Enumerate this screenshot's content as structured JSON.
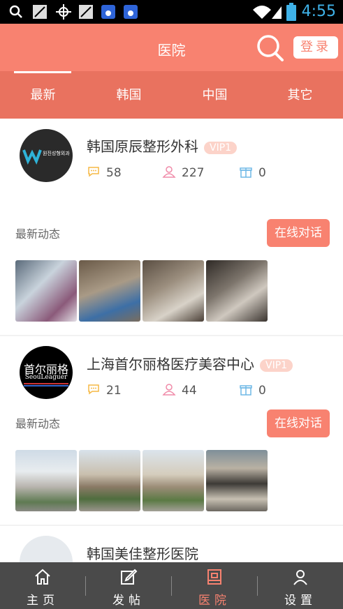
{
  "status_bar": {
    "time": "4:55"
  },
  "header": {
    "title": "医院",
    "login_label": "登录"
  },
  "tabs": [
    {
      "label": "最新",
      "active": true
    },
    {
      "label": "韩国",
      "active": false
    },
    {
      "label": "中国",
      "active": false
    },
    {
      "label": "其它",
      "active": false
    }
  ],
  "hospitals": [
    {
      "name": "韩国原辰整形外科",
      "badge": "VIP1",
      "comments": "58",
      "followers": "227",
      "gifts": "0",
      "news_label": "最新动态",
      "chat_label": "在线对话",
      "logo_text": "원진성형외과"
    },
    {
      "name": "上海首尔丽格医疗美容中心",
      "badge": "VIP1",
      "comments": "21",
      "followers": "44",
      "gifts": "0",
      "news_label": "最新动态",
      "chat_label": "在线对话",
      "logo_text": "首尔丽格",
      "logo_subtext": "SeouLeaguer"
    },
    {
      "name": "韩国美佳整形医院"
    }
  ],
  "bottom_nav": [
    {
      "label": "主页",
      "icon": "home-icon",
      "active": false
    },
    {
      "label": "发帖",
      "icon": "edit-icon",
      "active": false
    },
    {
      "label": "医院",
      "icon": "hospital-icon",
      "active": true
    },
    {
      "label": "设置",
      "icon": "user-icon",
      "active": false
    }
  ],
  "colors": {
    "accent": "#f88270",
    "tab_bar": "#e9725f",
    "bottom_bar": "#4a4a4a"
  }
}
